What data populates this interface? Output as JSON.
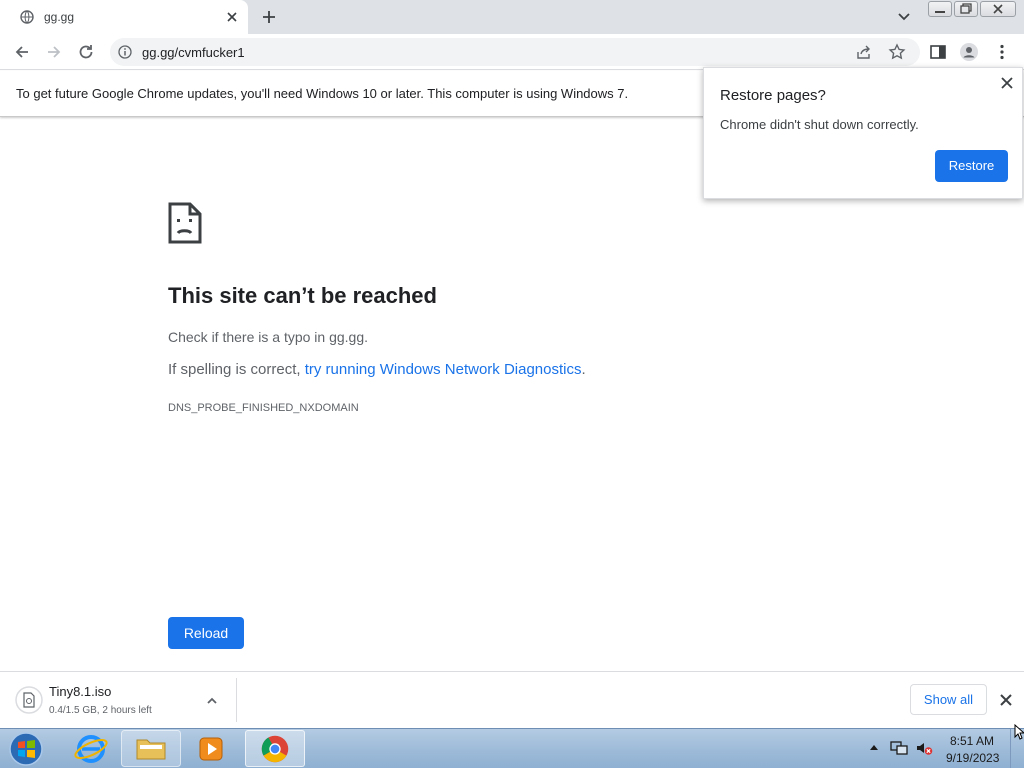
{
  "browser": {
    "tab": {
      "title": "gg.gg",
      "favicon": "globe-icon"
    },
    "address": {
      "url": "gg.gg/cvmfucker1"
    }
  },
  "infobar": {
    "text": "To get future Google Chrome updates, you'll need Windows 10 or later. This computer is using Windows 7."
  },
  "error_page": {
    "title": "This site can’t be reached",
    "line1": "Check if there is a typo in gg.gg.",
    "line2_prefix": "If spelling is correct, ",
    "line2_link": "try running Windows Network Diagnostics",
    "line2_suffix": ".",
    "code": "DNS_PROBE_FINISHED_NXDOMAIN",
    "reload_label": "Reload"
  },
  "restore_popup": {
    "title": "Restore pages?",
    "message": "Chrome didn't shut down correctly.",
    "button": "Restore"
  },
  "download_shelf": {
    "file_name": "Tiny8.1.iso",
    "status": "0.4/1.5 GB, 2 hours left",
    "show_all": "Show all"
  },
  "taskbar": {
    "items": [
      "internet-explorer-icon",
      "file-explorer-icon",
      "media-player-icon",
      "chrome-icon"
    ],
    "active_item": "chrome-icon",
    "clock": {
      "time": "8:51 AM",
      "date": "9/19/2023"
    }
  },
  "colors": {
    "accent": "#1a73e8",
    "tabstrip": "#dee1e6",
    "omnibox": "#f1f3f4"
  }
}
